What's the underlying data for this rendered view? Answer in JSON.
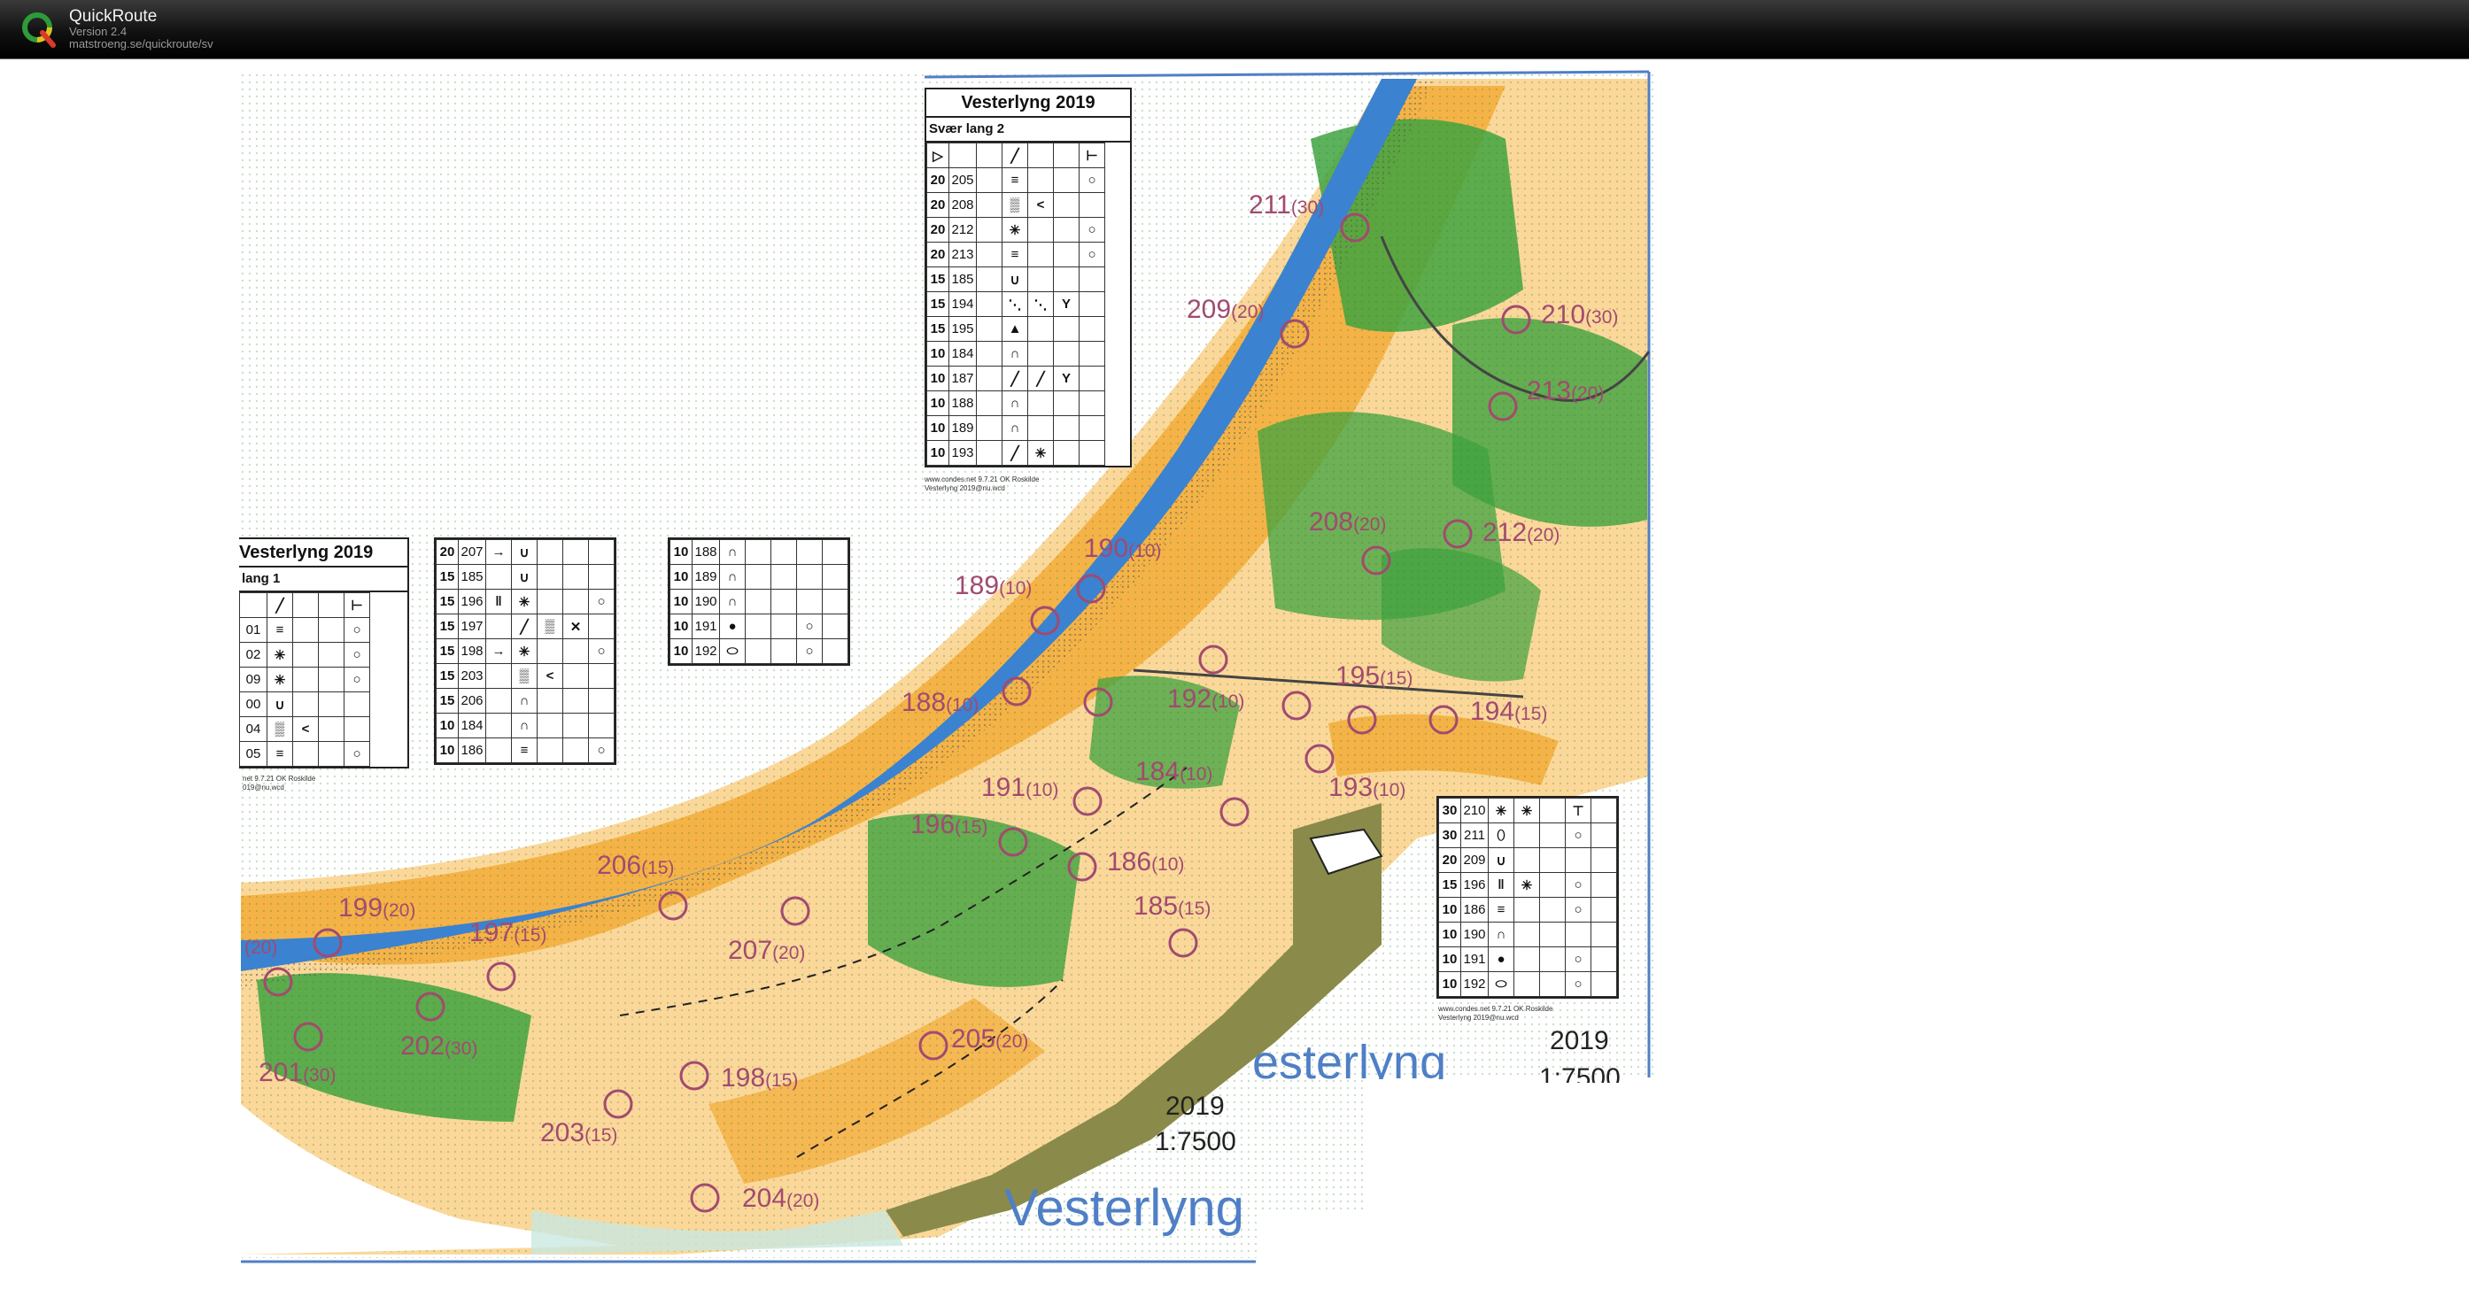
{
  "app": {
    "name": "QuickRoute",
    "version": "Version 2.4",
    "url": "matstroeng.se/quickroute/sv"
  },
  "colors": {
    "sea": "#3b82d0",
    "sand": "#f5b347",
    "light_sand": "#fbd89a",
    "forest": "#3fa33f",
    "marsh_olive": "#8a8a4a",
    "control_purple": "#a24a70",
    "frame_blue": "#4f7fc6"
  },
  "map": {
    "labels": {
      "name_main": "Vesterlyng",
      "name_partial": "esterlyng",
      "year_main": "2019",
      "scale_main": "1:7500",
      "year_right": "2019",
      "scale_right": "1:7500"
    },
    "controls": [
      {
        "num": "211",
        "pts": "(30)"
      },
      {
        "num": "209",
        "pts": "(20)"
      },
      {
        "num": "210",
        "pts": "(30)"
      },
      {
        "num": "213",
        "pts": "(20)"
      },
      {
        "num": "208",
        "pts": "(20)"
      },
      {
        "num": "212",
        "pts": "(20)"
      },
      {
        "num": "190",
        "pts": "(10)"
      },
      {
        "num": "189",
        "pts": "(10)"
      },
      {
        "num": "195",
        "pts": "(15)"
      },
      {
        "num": "194",
        "pts": "(15)"
      },
      {
        "num": "188",
        "pts": "(10)"
      },
      {
        "num": "192",
        "pts": "(10)"
      },
      {
        "num": "184",
        "pts": "(10)"
      },
      {
        "num": "193",
        "pts": "(10)"
      },
      {
        "num": "191",
        "pts": "(10)"
      },
      {
        "num": "196",
        "pts": "(15)"
      },
      {
        "num": "186",
        "pts": "(10)"
      },
      {
        "num": "185",
        "pts": "(15)"
      },
      {
        "num": "206",
        "pts": "(15)"
      },
      {
        "num": "199",
        "pts": "(20)"
      },
      {
        "num": "197",
        "pts": "(15)"
      },
      {
        "num": "207",
        "pts": "(20)"
      },
      {
        "num": "202",
        "pts": "(30)"
      },
      {
        "num": "205",
        "pts": "(20)"
      },
      {
        "num": "201",
        "pts": "(30)"
      },
      {
        "num": "198",
        "pts": "(15)"
      },
      {
        "num": "203",
        "pts": "(15)"
      },
      {
        "num": "204",
        "pts": "(20)"
      },
      {
        "num": "",
        "pts": "(20)"
      }
    ],
    "card_top": {
      "title": "Vesterlyng 2019",
      "course": "Svær lang 2",
      "rows": [
        [
          "20",
          "205"
        ],
        [
          "20",
          "208"
        ],
        [
          "20",
          "212"
        ],
        [
          "20",
          "213"
        ],
        [
          "15",
          "185"
        ],
        [
          "15",
          "194"
        ],
        [
          "15",
          "195"
        ],
        [
          "10",
          "184"
        ],
        [
          "10",
          "187"
        ],
        [
          "10",
          "188"
        ],
        [
          "10",
          "189"
        ],
        [
          "10",
          "193"
        ]
      ],
      "foot1": "www.condes.net 9.7.21 OK Roskilde",
      "foot2": "Vesterlyng 2019@nu.wcd"
    },
    "card_left": {
      "title": "Vesterlyng 2019",
      "course": "lang 1",
      "rows": [
        [
          "",
          "01"
        ],
        [
          "",
          "02"
        ],
        [
          "",
          "09"
        ],
        [
          "",
          "00"
        ],
        [
          "",
          "04"
        ],
        [
          "",
          "05"
        ]
      ],
      "foot1": "net 9.7.21 OK Roskilde",
      "foot2": "019@nu.wcd"
    },
    "card_left_mid": {
      "rows": [
        [
          "20",
          "207"
        ],
        [
          "15",
          "185"
        ],
        [
          "15",
          "196"
        ],
        [
          "15",
          "197"
        ],
        [
          "15",
          "198"
        ],
        [
          "15",
          "203"
        ],
        [
          "15",
          "206"
        ],
        [
          "10",
          "184"
        ],
        [
          "10",
          "186"
        ]
      ]
    },
    "card_left_right": {
      "rows": [
        [
          "10",
          "188"
        ],
        [
          "10",
          "189"
        ],
        [
          "10",
          "190"
        ],
        [
          "10",
          "191"
        ],
        [
          "10",
          "192"
        ]
      ]
    },
    "card_right": {
      "rows": [
        [
          "30",
          "210"
        ],
        [
          "30",
          "211"
        ],
        [
          "20",
          "209"
        ],
        [
          "15",
          "196"
        ],
        [
          "10",
          "186"
        ],
        [
          "10",
          "190"
        ],
        [
          "10",
          "191"
        ],
        [
          "10",
          "192"
        ]
      ],
      "foot1": "www.condes.net 9.7.21 OK Roskilde",
      "foot2": "Vesterlyng 2019@nu.wcd"
    }
  }
}
